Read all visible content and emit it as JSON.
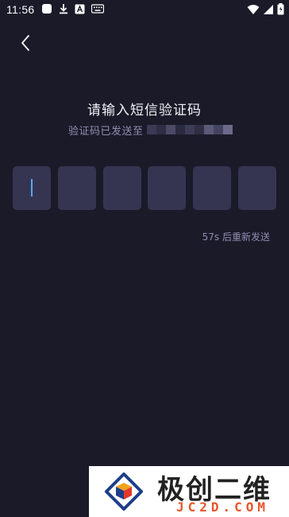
{
  "status_bar": {
    "time": "11:56",
    "left_icons": [
      "square-notification-icon",
      "download-icon",
      "a-notification-icon",
      "keyboard-icon"
    ],
    "right_icons": [
      "wifi-icon",
      "signal-icon",
      "battery-icon"
    ]
  },
  "header": {
    "back_icon": "chevron-left-icon"
  },
  "verify": {
    "title": "请输入短信验证码",
    "subtitle": "验证码已发送至",
    "masked_colors": [
      "#3a3a55",
      "#2e2d45",
      "#4a4966",
      "#2a2a3f",
      "#3d3c57",
      "#2f2e44",
      "#5a5978",
      "#44435f",
      "#6b6a8a"
    ],
    "code_digits": [
      "",
      "",
      "",
      "",
      "",
      ""
    ],
    "resend_text": "57s 后重新发送"
  },
  "colors": {
    "background": "#1b1a29",
    "box": "#363551",
    "cursor": "#5aa6ff",
    "muted": "#8e8eb0"
  },
  "watermark": {
    "brand_cn": "极创二维",
    "brand_en": "JC2D.COM"
  }
}
